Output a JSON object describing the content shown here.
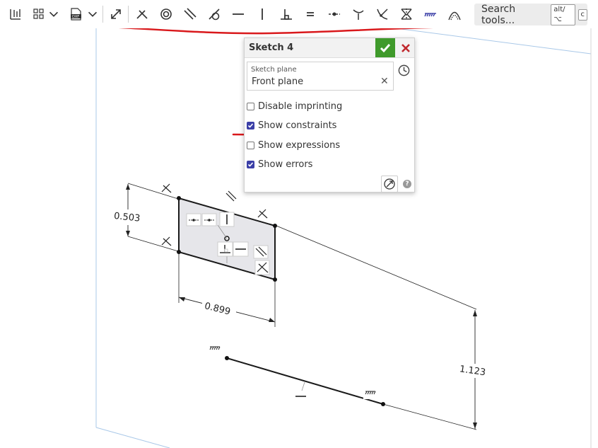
{
  "toolbar": {
    "search_label": "Search tools...",
    "search_shortcut_1": "alt/⌥",
    "search_shortcut_2": "c",
    "icons": [
      "toggle-bar-icon",
      "grid-view-icon",
      "dropdown-icon",
      "dxf-import-icon",
      "dropdown-icon",
      "transform-icon",
      "coincident-icon",
      "concentric-icon",
      "parallel-icon",
      "tangent-icon",
      "horizontal-icon",
      "vertical-icon",
      "perpendicular-icon",
      "equal-icon",
      "midpoint-icon",
      "normal-icon",
      "pierce-icon",
      "symmetric-icon",
      "fix-icon",
      "curvature-icon"
    ]
  },
  "dialog": {
    "title": "Sketch 4",
    "sketch_plane_label": "Sketch plane",
    "sketch_plane_value": "Front plane",
    "clear_symbol": "✕",
    "options": [
      {
        "label": "Disable imprinting",
        "checked": false
      },
      {
        "label": "Show constraints",
        "checked": true
      },
      {
        "label": "Show expressions",
        "checked": false
      },
      {
        "label": "Show errors",
        "checked": true
      }
    ],
    "help_symbol": "?"
  },
  "sketch": {
    "dimensions": {
      "height": "0.503",
      "width": "0.899",
      "offset": "1.123"
    }
  },
  "colors": {
    "accent": "#3b3fa7",
    "ok_green": "#3f9a2b",
    "annotation_red": "#d9191c",
    "sketch_fill": "#e6e6ea",
    "plane_blue": "#a9c8e8"
  }
}
